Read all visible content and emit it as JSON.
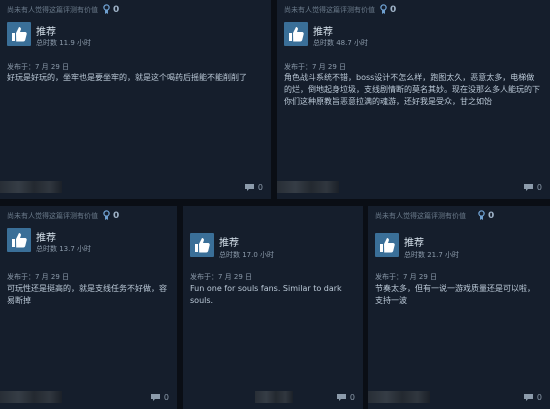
{
  "reviews": [
    {
      "helpful_text": "尚未有人觉得这篇评测有价值",
      "award_count": "0",
      "recommendation": "推荐",
      "hours": "总时数 11.9 小时",
      "posted": "发布于：7 月 29 日",
      "text": "好玩是好玩的，坐牢也是要坐牢的，就是这个喝药后摇能不能削削了",
      "comments": "0"
    },
    {
      "helpful_text": "尚未有人觉得这篇评测有价值",
      "award_count": "0",
      "recommendation": "推荐",
      "hours": "总时数 48.7 小时",
      "posted": "发布于：7 月 29 日",
      "text": "角色战斗系统不错，boss设计不怎么样，跑图太久，恶意太多，电梯做的烂，倒地起身垃圾，支线剧情断的莫名其妙。现在没那么多人能玩的下你们这种原教旨恶意拉满的魂游，还好我是受众，甘之如饴",
      "comments": "0"
    },
    {
      "helpful_text": "尚未有人觉得这篇评测有价值",
      "award_count": "0",
      "recommendation": "推荐",
      "hours": "总时数 13.7 小时",
      "posted": "发布于：7 月 29 日",
      "text": "可玩性还是挺高的，就是支线任务不好做，容易断掉",
      "comments": "0"
    },
    {
      "helpful_text": "",
      "award_count": "",
      "recommendation": "推荐",
      "hours": "总时数 17.0 小时",
      "posted": "发布于：7 月 29 日",
      "text": "Fun one for souls fans. Similar to dark souls.",
      "comments": "0"
    },
    {
      "helpful_text": "尚未有人觉得这篇评测有价值",
      "award_count": "0",
      "recommendation": "推荐",
      "hours": "总时数 21.7 小时",
      "posted": "发布于：7 月 29 日",
      "text": "节奏太多，但有一说一游戏质量还是可以啦，支持一波",
      "comments": "0"
    }
  ],
  "icons": {
    "thumb": "thumbs-up-icon",
    "award": "award-icon",
    "comment": "comment-icon"
  },
  "colors": {
    "thumb_bg": "#3a6f98",
    "card_bg": "#151e2c",
    "page_bg": "#0a0e15"
  }
}
